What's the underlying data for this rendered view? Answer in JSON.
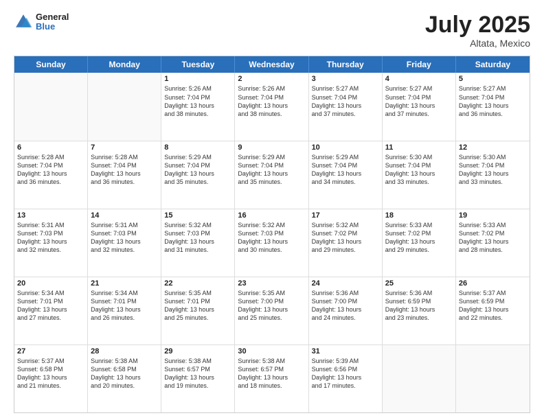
{
  "header": {
    "logo_line1": "General",
    "logo_line2": "Blue",
    "month_year": "July 2025",
    "location": "Altata, Mexico"
  },
  "days_of_week": [
    "Sunday",
    "Monday",
    "Tuesday",
    "Wednesday",
    "Thursday",
    "Friday",
    "Saturday"
  ],
  "weeks": [
    [
      {
        "day": "",
        "empty": true
      },
      {
        "day": "",
        "empty": true
      },
      {
        "day": "1",
        "lines": [
          "Sunrise: 5:26 AM",
          "Sunset: 7:04 PM",
          "Daylight: 13 hours",
          "and 38 minutes."
        ]
      },
      {
        "day": "2",
        "lines": [
          "Sunrise: 5:26 AM",
          "Sunset: 7:04 PM",
          "Daylight: 13 hours",
          "and 38 minutes."
        ]
      },
      {
        "day": "3",
        "lines": [
          "Sunrise: 5:27 AM",
          "Sunset: 7:04 PM",
          "Daylight: 13 hours",
          "and 37 minutes."
        ]
      },
      {
        "day": "4",
        "lines": [
          "Sunrise: 5:27 AM",
          "Sunset: 7:04 PM",
          "Daylight: 13 hours",
          "and 37 minutes."
        ]
      },
      {
        "day": "5",
        "lines": [
          "Sunrise: 5:27 AM",
          "Sunset: 7:04 PM",
          "Daylight: 13 hours",
          "and 36 minutes."
        ]
      }
    ],
    [
      {
        "day": "6",
        "lines": [
          "Sunrise: 5:28 AM",
          "Sunset: 7:04 PM",
          "Daylight: 13 hours",
          "and 36 minutes."
        ]
      },
      {
        "day": "7",
        "lines": [
          "Sunrise: 5:28 AM",
          "Sunset: 7:04 PM",
          "Daylight: 13 hours",
          "and 36 minutes."
        ]
      },
      {
        "day": "8",
        "lines": [
          "Sunrise: 5:29 AM",
          "Sunset: 7:04 PM",
          "Daylight: 13 hours",
          "and 35 minutes."
        ]
      },
      {
        "day": "9",
        "lines": [
          "Sunrise: 5:29 AM",
          "Sunset: 7:04 PM",
          "Daylight: 13 hours",
          "and 35 minutes."
        ]
      },
      {
        "day": "10",
        "lines": [
          "Sunrise: 5:29 AM",
          "Sunset: 7:04 PM",
          "Daylight: 13 hours",
          "and 34 minutes."
        ]
      },
      {
        "day": "11",
        "lines": [
          "Sunrise: 5:30 AM",
          "Sunset: 7:04 PM",
          "Daylight: 13 hours",
          "and 33 minutes."
        ]
      },
      {
        "day": "12",
        "lines": [
          "Sunrise: 5:30 AM",
          "Sunset: 7:04 PM",
          "Daylight: 13 hours",
          "and 33 minutes."
        ]
      }
    ],
    [
      {
        "day": "13",
        "lines": [
          "Sunrise: 5:31 AM",
          "Sunset: 7:03 PM",
          "Daylight: 13 hours",
          "and 32 minutes."
        ]
      },
      {
        "day": "14",
        "lines": [
          "Sunrise: 5:31 AM",
          "Sunset: 7:03 PM",
          "Daylight: 13 hours",
          "and 32 minutes."
        ]
      },
      {
        "day": "15",
        "lines": [
          "Sunrise: 5:32 AM",
          "Sunset: 7:03 PM",
          "Daylight: 13 hours",
          "and 31 minutes."
        ]
      },
      {
        "day": "16",
        "lines": [
          "Sunrise: 5:32 AM",
          "Sunset: 7:03 PM",
          "Daylight: 13 hours",
          "and 30 minutes."
        ]
      },
      {
        "day": "17",
        "lines": [
          "Sunrise: 5:32 AM",
          "Sunset: 7:02 PM",
          "Daylight: 13 hours",
          "and 29 minutes."
        ]
      },
      {
        "day": "18",
        "lines": [
          "Sunrise: 5:33 AM",
          "Sunset: 7:02 PM",
          "Daylight: 13 hours",
          "and 29 minutes."
        ]
      },
      {
        "day": "19",
        "lines": [
          "Sunrise: 5:33 AM",
          "Sunset: 7:02 PM",
          "Daylight: 13 hours",
          "and 28 minutes."
        ]
      }
    ],
    [
      {
        "day": "20",
        "lines": [
          "Sunrise: 5:34 AM",
          "Sunset: 7:01 PM",
          "Daylight: 13 hours",
          "and 27 minutes."
        ]
      },
      {
        "day": "21",
        "lines": [
          "Sunrise: 5:34 AM",
          "Sunset: 7:01 PM",
          "Daylight: 13 hours",
          "and 26 minutes."
        ]
      },
      {
        "day": "22",
        "lines": [
          "Sunrise: 5:35 AM",
          "Sunset: 7:01 PM",
          "Daylight: 13 hours",
          "and 25 minutes."
        ]
      },
      {
        "day": "23",
        "lines": [
          "Sunrise: 5:35 AM",
          "Sunset: 7:00 PM",
          "Daylight: 13 hours",
          "and 25 minutes."
        ]
      },
      {
        "day": "24",
        "lines": [
          "Sunrise: 5:36 AM",
          "Sunset: 7:00 PM",
          "Daylight: 13 hours",
          "and 24 minutes."
        ]
      },
      {
        "day": "25",
        "lines": [
          "Sunrise: 5:36 AM",
          "Sunset: 6:59 PM",
          "Daylight: 13 hours",
          "and 23 minutes."
        ]
      },
      {
        "day": "26",
        "lines": [
          "Sunrise: 5:37 AM",
          "Sunset: 6:59 PM",
          "Daylight: 13 hours",
          "and 22 minutes."
        ]
      }
    ],
    [
      {
        "day": "27",
        "lines": [
          "Sunrise: 5:37 AM",
          "Sunset: 6:58 PM",
          "Daylight: 13 hours",
          "and 21 minutes."
        ]
      },
      {
        "day": "28",
        "lines": [
          "Sunrise: 5:38 AM",
          "Sunset: 6:58 PM",
          "Daylight: 13 hours",
          "and 20 minutes."
        ]
      },
      {
        "day": "29",
        "lines": [
          "Sunrise: 5:38 AM",
          "Sunset: 6:57 PM",
          "Daylight: 13 hours",
          "and 19 minutes."
        ]
      },
      {
        "day": "30",
        "lines": [
          "Sunrise: 5:38 AM",
          "Sunset: 6:57 PM",
          "Daylight: 13 hours",
          "and 18 minutes."
        ]
      },
      {
        "day": "31",
        "lines": [
          "Sunrise: 5:39 AM",
          "Sunset: 6:56 PM",
          "Daylight: 13 hours",
          "and 17 minutes."
        ]
      },
      {
        "day": "",
        "empty": true
      },
      {
        "day": "",
        "empty": true
      }
    ]
  ]
}
